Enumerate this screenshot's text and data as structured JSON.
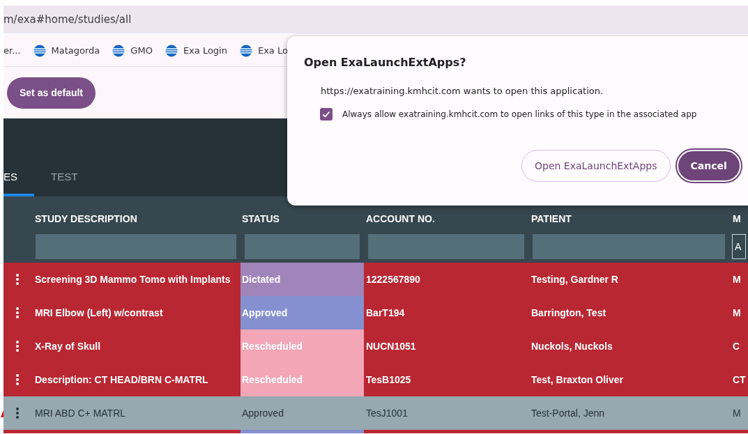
{
  "address_bar": {
    "url": "m/exa#home/studies/all"
  },
  "truncated_bookmark": "er...",
  "bookmarks": [
    {
      "label": "Matagorda"
    },
    {
      "label": "GMO"
    },
    {
      "label": "Exa Login"
    },
    {
      "label": "Exa Lo"
    }
  ],
  "default_button": "Set as default",
  "tabs": [
    {
      "label": "ES",
      "selected": true
    },
    {
      "label": "TEST",
      "selected": false
    }
  ],
  "table": {
    "columns": [
      {
        "label": "STUDY DESCRIPTION"
      },
      {
        "label": "STATUS"
      },
      {
        "label": "ACCOUNT NO."
      },
      {
        "label": "PATIENT"
      },
      {
        "label": "M",
        "filter": "A"
      }
    ],
    "rows": [
      {
        "kind": "flagged",
        "color": "#b92733",
        "alert": false,
        "description": "Screening 3D Mammo Tomo with Implants",
        "status": {
          "label": "Dictated",
          "color": "#a084ba"
        },
        "account": "1222567890",
        "patient": "Testing, Gardner R",
        "column_5": "M"
      },
      {
        "kind": "flagged",
        "color": "#b92733",
        "alert": false,
        "description": "MRI Elbow (Left) w/contrast",
        "status": {
          "label": "Approved",
          "color": "#8490d0"
        },
        "account": "BarT194",
        "patient": "Barrington, Test",
        "column_5": "M"
      },
      {
        "kind": "flagged",
        "color": "#b92733",
        "alert": false,
        "description": "X-Ray of Skull",
        "status": {
          "label": "Rescheduled",
          "color": "#f2a6b6"
        },
        "account": "NUCN1051",
        "patient": "Nuckols, Nuckols",
        "column_5": "C"
      },
      {
        "kind": "flagged",
        "color": "#b92733",
        "alert": false,
        "description": "Description: CT HEAD/BRN C-MATRL",
        "status": {
          "label": "Rescheduled",
          "color": "#f2a6b6"
        },
        "account": "TesB1025",
        "patient": "Test, Braxton Oliver",
        "column_5": "CT"
      },
      {
        "kind": "normal",
        "color": "#96a8b0",
        "alert": true,
        "description": "MRI ABD C+ MATRL",
        "status": {
          "label": "Approved",
          "color": "#96a8b0"
        },
        "account": "TesJ1001",
        "patient": "Test-Portal, Jenn",
        "column_5": "M"
      },
      {
        "kind": "flagged",
        "color": "#b92733",
        "status": {
          "color": "#8490d0"
        }
      }
    ]
  },
  "dialog": {
    "title": "Open ExaLaunchExtApps?",
    "message": "https://exatraining.kmhcit.com wants to open this application.",
    "checkbox": {
      "label": "Always allow exatraining.kmhcit.com to open links of this type in the associated app",
      "checked": true
    },
    "buttons": [
      {
        "label": "Open ExaLaunchExtApps",
        "kind": "outlined"
      },
      {
        "label": "Cancel",
        "kind": "filled"
      }
    ]
  }
}
